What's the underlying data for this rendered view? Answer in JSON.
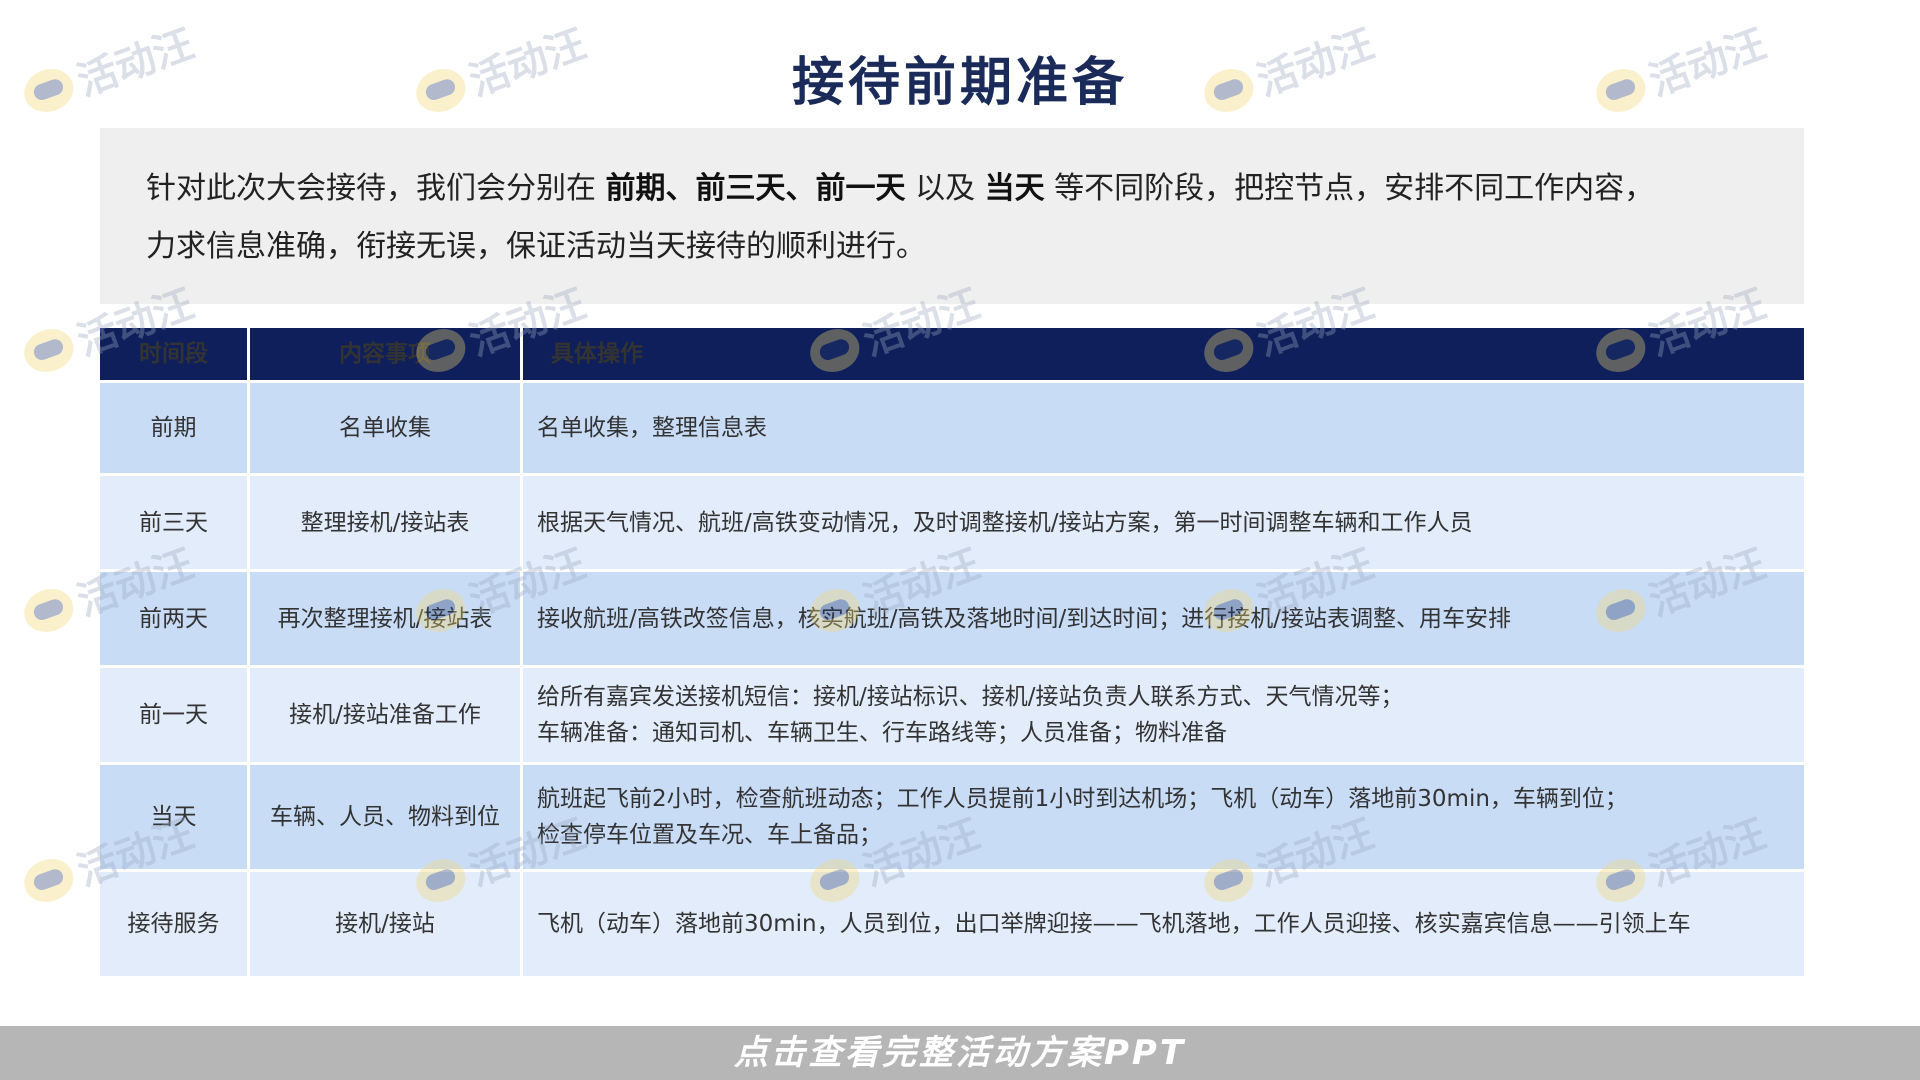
{
  "title": "接待前期准备",
  "intro": {
    "line1_pre": "针对此次大会接待，我们会分别在 ",
    "line1_bold1": "前期、前三天、前一天",
    "line1_mid": " 以及 ",
    "line1_bold2": "当天",
    "line1_post": " 等不同阶段，把控节点，安排不同工作内容，",
    "line2": "力求信息准确，衔接无误，保证活动当天接待的顺利进行。"
  },
  "table": {
    "headers": [
      "时间段",
      "内容事项",
      "具体操作"
    ],
    "rows": [
      {
        "period": "前期",
        "item": "名单收集",
        "ops": [
          "名单收集，整理信息表"
        ]
      },
      {
        "period": "前三天",
        "item": "整理接机/接站表",
        "ops": [
          "根据天气情况、航班/高铁变动情况，及时调整接机/接站方案，第一时间调整车辆和工作人员"
        ]
      },
      {
        "period": "前两天",
        "item": "再次整理接机/接站表",
        "ops": [
          "接收航班/高铁改签信息，核实航班/高铁及落地时间/到达时间；进行接机/接站表调整、用车安排"
        ]
      },
      {
        "period": "前一天",
        "item": "接机/接站准备工作",
        "ops": [
          "给所有嘉宾发送接机短信：接机/接站标识、接机/接站负责人联系方式、天气情况等；",
          "车辆准备：通知司机、车辆卫生、行车路线等；人员准备；物料准备"
        ]
      },
      {
        "period": "当天",
        "item": "车辆、人员、物料到位",
        "ops": [
          "航班起飞前2小时，检查航班动态；工作人员提前1小时到达机场；飞机（动车）落地前30min，车辆到位；",
          "检查停车位置及车况、车上备品；"
        ]
      },
      {
        "period": "接待服务",
        "item": "接机/接站",
        "ops": [
          "飞机（动车）落地前30min，人员到位，出口举牌迎接——飞机落地，工作人员迎接、核实嘉宾信息——引领上车"
        ]
      }
    ]
  },
  "footer": {
    "label": "点击查看完整活动方案PPT"
  },
  "watermark": {
    "text": "活动汪"
  },
  "colors": {
    "header_bg": "#0e1f5b",
    "row_dark": "#c9dcf6",
    "row_light": "#e2ecfa",
    "title": "#1a2b5a",
    "footer_bg": "#b6b6b6"
  }
}
